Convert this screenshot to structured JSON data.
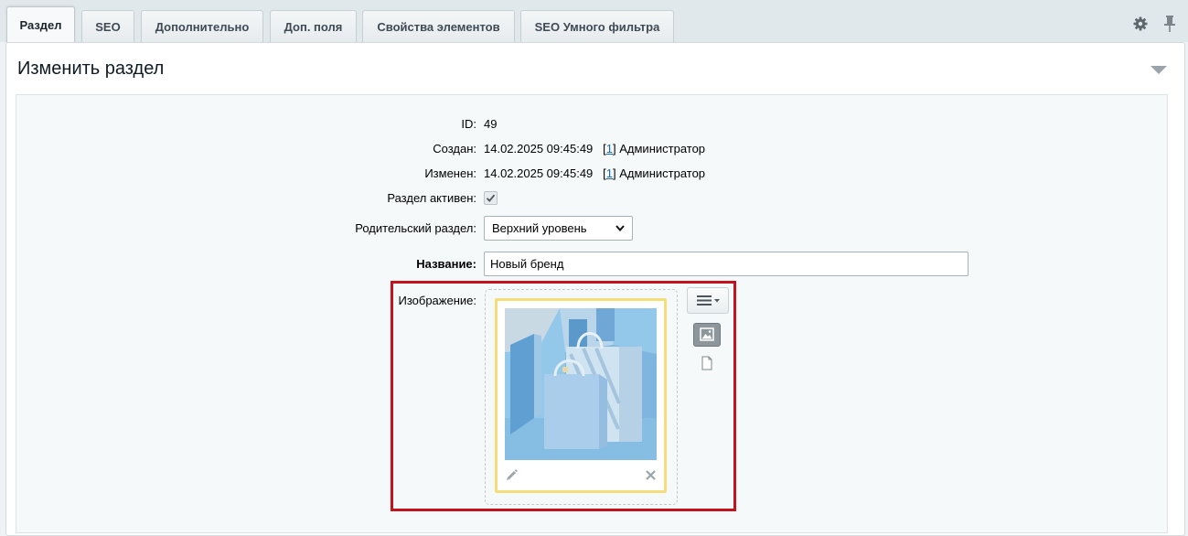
{
  "tabs": [
    {
      "label": "Раздел",
      "active": true
    },
    {
      "label": "SEO",
      "active": false
    },
    {
      "label": "Дополнительно",
      "active": false
    },
    {
      "label": "Доп. поля",
      "active": false
    },
    {
      "label": "Свойства элементов",
      "active": false
    },
    {
      "label": "SEO Умного фильтра",
      "active": false
    }
  ],
  "toolbar_icons": [
    "gear-icon",
    "pin-icon"
  ],
  "panel": {
    "title": "Изменить раздел",
    "collapse_icon": "triangle-down-icon"
  },
  "form": {
    "id": {
      "label": "ID:",
      "value": "49"
    },
    "created": {
      "label": "Создан:",
      "datetime": "14.02.2025 09:45:49",
      "open_bracket": "[",
      "user_id": "1",
      "close_bracket": "]",
      "user_name": "Администратор"
    },
    "modified": {
      "label": "Изменен:",
      "datetime": "14.02.2025 09:45:49",
      "open_bracket": "[",
      "user_id": "1",
      "close_bracket": "]",
      "user_name": "Администратор"
    },
    "active": {
      "label": "Раздел активен:",
      "checked": true
    },
    "parent": {
      "label": "Родительский раздел:",
      "selected": "Верхний уровень"
    },
    "name": {
      "label": "Название:",
      "value": "Новый бренд"
    },
    "image": {
      "label": "Изображение:",
      "icons": [
        "menu-icon",
        "image-icon",
        "file-icon",
        "pencil-icon",
        "close-icon"
      ]
    }
  },
  "colors": {
    "highlight_border": "#c3131c",
    "preview_border": "#f5de7a",
    "link": "#2067b0"
  }
}
